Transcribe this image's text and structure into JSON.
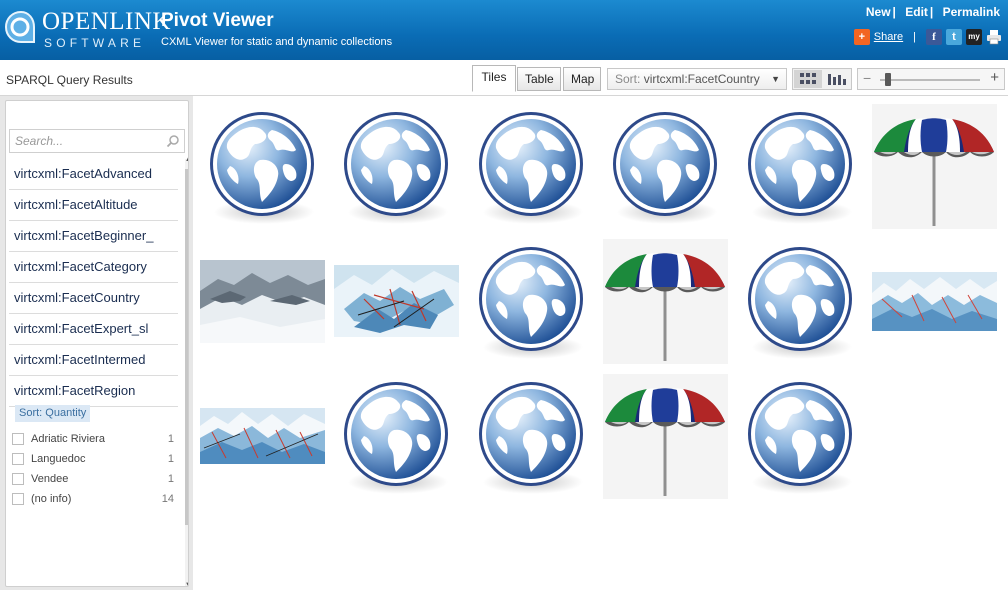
{
  "header": {
    "logo_top": "OPENLINK",
    "logo_bottom": "SOFTWARE",
    "title": "Pivot Viewer",
    "subtitle": "CXML Viewer for static and dynamic collections",
    "links": [
      "New",
      "Edit",
      "Permalink"
    ],
    "share_label": "Share",
    "brand_color": "#0a6cb5",
    "social_icons": [
      "share-plus-icon",
      "facebook-icon",
      "twitter-icon",
      "myspace-icon",
      "print-icon"
    ]
  },
  "toolbar": {
    "title": "SPARQL Query Results",
    "tabs": [
      "Tiles",
      "Table",
      "Map"
    ],
    "active_tab": "Tiles",
    "sort_prefix": "Sort:",
    "sort_value": "virtcxml:FacetCountry",
    "view_modes": [
      "grid-view-icon",
      "bar-chart-view-icon"
    ],
    "zoom_level": 0.05
  },
  "sidebar": {
    "search_placeholder": "Search...",
    "facets": [
      "virtcxml:FacetAdvanced",
      "virtcxml:FacetAltitude",
      "virtcxml:FacetBeginner_",
      "virtcxml:FacetCategory",
      "virtcxml:FacetCountry",
      "virtcxml:FacetExpert_sl",
      "virtcxml:FacetIntermed",
      "virtcxml:FacetRegion"
    ],
    "sort_label": "Sort: Quantity",
    "facet_values": [
      {
        "label": "Adriatic Riviera",
        "count": "1"
      },
      {
        "label": "Languedoc",
        "count": "1"
      },
      {
        "label": "Vendee",
        "count": "1"
      },
      {
        "label": "(no info)",
        "count": "14"
      }
    ]
  },
  "tiles": {
    "rows": [
      [
        "globe",
        "globe",
        "globe",
        "globe",
        "globe",
        "umbrella"
      ],
      [
        "photo-snow",
        "map-piste",
        "globe",
        "umbrella",
        "globe",
        "map-panorama"
      ],
      [
        "map-panorama2",
        "globe",
        "globe",
        "umbrella",
        "globe"
      ]
    ]
  }
}
